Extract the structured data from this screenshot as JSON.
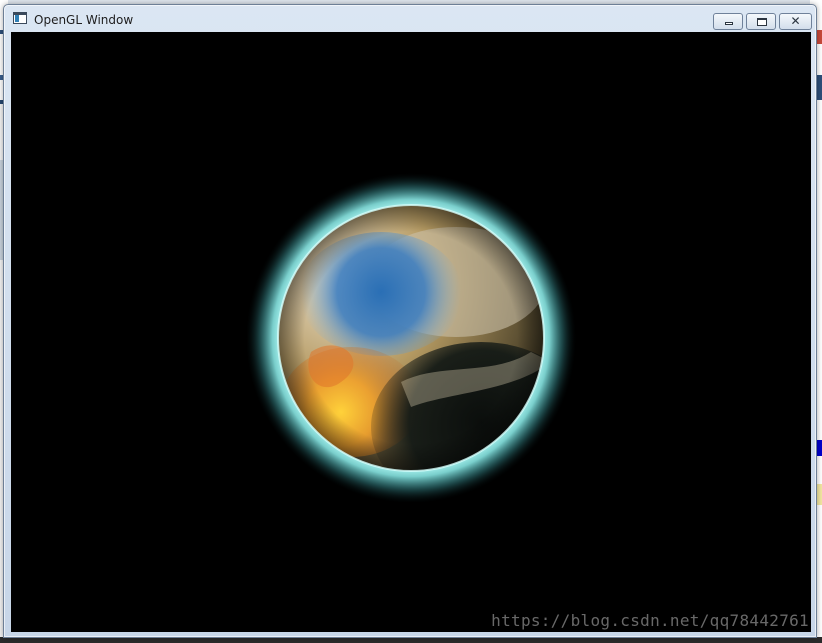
{
  "window": {
    "title": "OpenGL Window",
    "controls": {
      "minimize_icon": "minimize-icon",
      "maximize_icon": "maximize-icon",
      "close_glyph": "✕"
    }
  },
  "canvas": {
    "background": "#000000",
    "glow_color": "#8ff3f0",
    "watermark": "https://blog.csdn.net/qq78442761"
  }
}
